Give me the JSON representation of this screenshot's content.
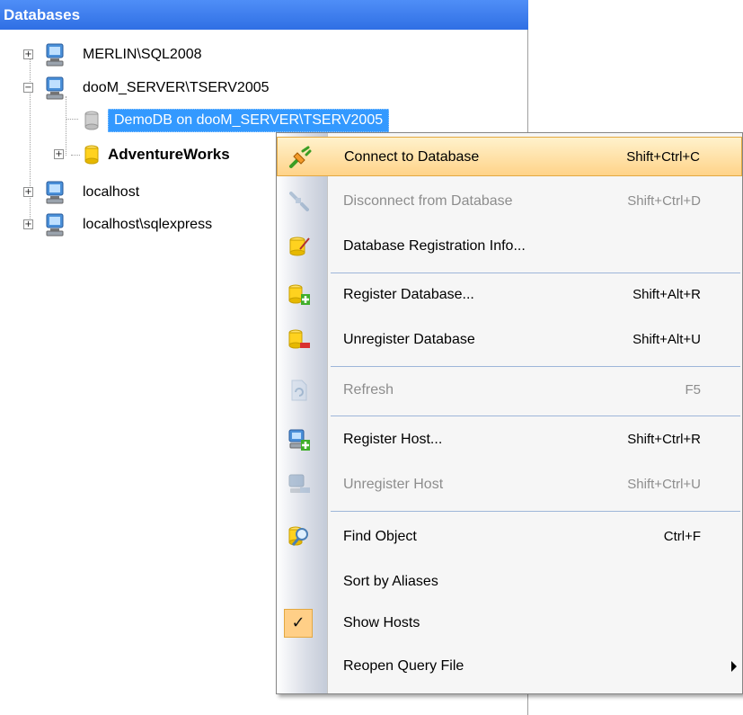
{
  "panel": {
    "title": "Databases"
  },
  "tree": {
    "nodes": [
      {
        "label": "MERLIN\\SQL2008",
        "type": "host",
        "toggle": "+"
      },
      {
        "label": "dooM_SERVER\\TSERV2005",
        "type": "host",
        "toggle": "−"
      },
      {
        "label": "DemoDB on dooM_SERVER\\TSERV2005",
        "type": "database",
        "state": "selected"
      },
      {
        "label": "AdventureWorks",
        "type": "database",
        "toggle": "+",
        "state": "bold"
      },
      {
        "label": "localhost",
        "type": "host",
        "toggle": "+"
      },
      {
        "label": "localhost\\sqlexpress",
        "type": "host",
        "toggle": "+"
      }
    ]
  },
  "menu": {
    "items": [
      {
        "label": "Connect to Database",
        "shortcut": "Shift+Ctrl+C",
        "icon": "connect-icon",
        "state": "highlighted"
      },
      {
        "label": "Disconnect from Database",
        "shortcut": "Shift+Ctrl+D",
        "icon": "disconnect-icon",
        "state": "disabled"
      },
      {
        "label": "Database Registration Info...",
        "shortcut": "",
        "icon": "database-info-icon"
      },
      {
        "label": "Register Database...",
        "shortcut": "Shift+Alt+R",
        "icon": "register-database-icon"
      },
      {
        "label": "Unregister Database",
        "shortcut": "Shift+Alt+U",
        "icon": "unregister-database-icon"
      },
      {
        "label": "Refresh",
        "shortcut": "F5",
        "icon": "refresh-icon",
        "state": "disabled"
      },
      {
        "label": "Register Host...",
        "shortcut": "Shift+Ctrl+R",
        "icon": "register-host-icon"
      },
      {
        "label": "Unregister Host",
        "shortcut": "Shift+Ctrl+U",
        "icon": "unregister-host-icon",
        "state": "disabled"
      },
      {
        "label": "Find Object",
        "shortcut": "Ctrl+F",
        "icon": "find-object-icon"
      },
      {
        "label": "Sort by Aliases",
        "shortcut": ""
      },
      {
        "label": "Show Hosts",
        "shortcut": "",
        "checked": true
      },
      {
        "label": "Reopen Query File",
        "shortcut": "",
        "submenu": true
      }
    ],
    "check_glyph": "✓"
  },
  "colors": {
    "header": "#2f6fe4",
    "selection": "#3399ff",
    "highlight": "#ffd389",
    "disabled_text": "#8d8d8d"
  }
}
